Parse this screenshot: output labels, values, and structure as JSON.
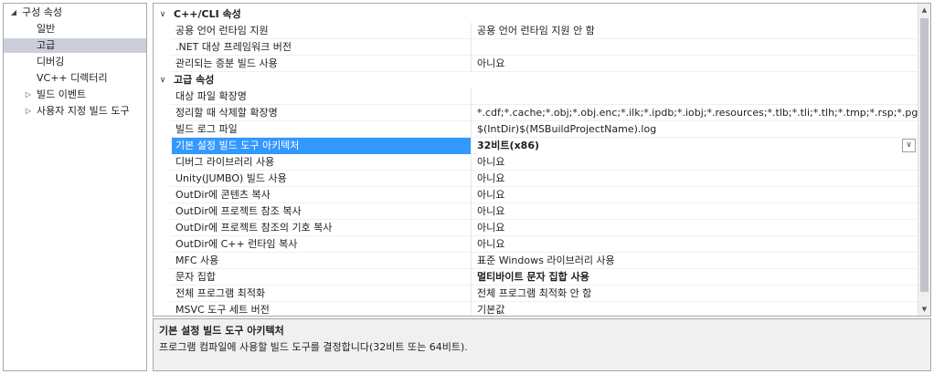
{
  "tree": {
    "root": "구성 속성",
    "items": [
      {
        "label": "일반"
      },
      {
        "label": "고급"
      },
      {
        "label": "디버깅"
      },
      {
        "label": "VC++ 디렉터리"
      },
      {
        "label": "빌드 이벤트"
      },
      {
        "label": "사용자 지정 빌드 도구"
      }
    ]
  },
  "grid": {
    "cat1": "C++/CLI 속성",
    "cat1_rows": [
      {
        "name": "공용 언어 런타임 지원",
        "value": "공용 언어 런타임 지원 안 함"
      },
      {
        "name": ".NET 대상 프레임워크 버전",
        "value": ""
      },
      {
        "name": "관리되는 증분 빌드 사용",
        "value": "아니요"
      }
    ],
    "cat2": "고급 속성",
    "cat2_rows": [
      {
        "name": "대상 파일 확장명",
        "value": ""
      },
      {
        "name": "정리할 때 삭제할 확장명",
        "value": "*.cdf;*.cache;*.obj;*.obj.enc;*.ilk;*.ipdb;*.iobj;*.resources;*.tlb;*.tli;*.tlh;*.tmp;*.rsp;*.pgc;*.pgd;*.meta;*.tlog;*.manifest"
      },
      {
        "name": "빌드 로그 파일",
        "value": "$(IntDir)$(MSBuildProjectName).log"
      },
      {
        "name": "기본 설정 빌드 도구 아키텍처",
        "value": "32비트(x86)"
      },
      {
        "name": "디버그 라이브러리 사용",
        "value": "아니요"
      },
      {
        "name": "Unity(JUMBO) 빌드 사용",
        "value": "아니요"
      },
      {
        "name": "OutDir에 콘텐츠 복사",
        "value": "아니요"
      },
      {
        "name": "OutDir에 프로젝트 참조 복사",
        "value": "아니요"
      },
      {
        "name": "OutDir에 프로젝트 참조의 기호 복사",
        "value": "아니요"
      },
      {
        "name": "OutDir에 C++ 런타임 복사",
        "value": "아니요"
      },
      {
        "name": "MFC 사용",
        "value": "표준 Windows 라이브러리 사용"
      },
      {
        "name": "문자 집합",
        "value": "멀티바이트 문자 집합 사용"
      },
      {
        "name": "전체 프로그램 최적화",
        "value": "전체 프로그램 최적화 안 함"
      },
      {
        "name": "MSVC 도구 세트 버전",
        "value": "기본값"
      }
    ]
  },
  "description": {
    "title": "기본 설정 빌드 도구 아키텍처",
    "text": "프로그램 컴파일에 사용할 빌드 도구를 결정합니다(32비트 또는 64비트)."
  },
  "colors": {
    "selection": "#3399ff",
    "tree_selection": "#cccedb",
    "panel_bg": "#f0f0f0"
  }
}
